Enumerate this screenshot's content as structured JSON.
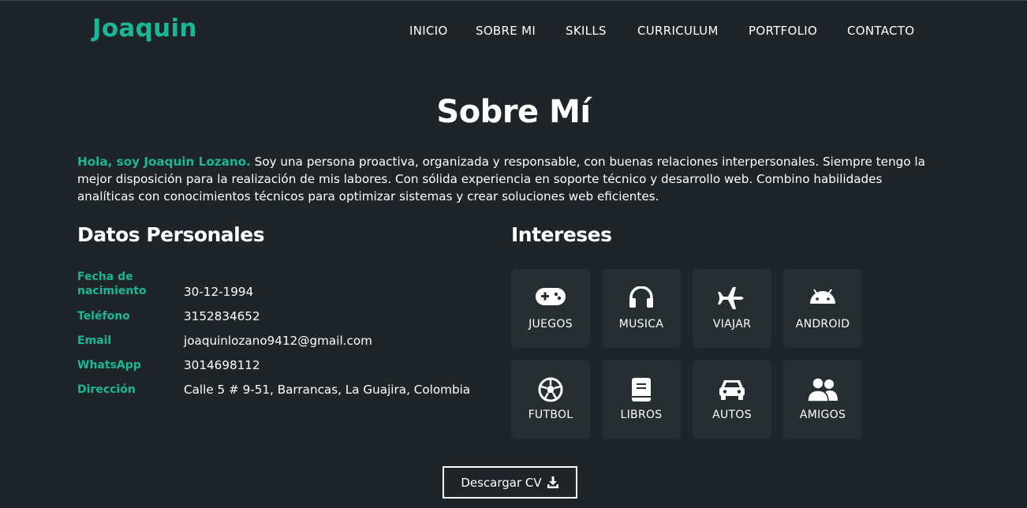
{
  "brand": "Joaquin",
  "nav": [
    "INICIO",
    "SOBRE MI",
    "SKILLS",
    "CURRICULUM",
    "PORTFOLIO",
    "CONTACTO"
  ],
  "section_title": "Sobre Mí",
  "intro": {
    "highlight": "Hola, soy Joaquin Lozano.",
    "text": " Soy una persona proactiva, organizada y responsable, con buenas relaciones interpersonales. Siempre tengo la mejor disposición para la realización de mis labores. Con sólida experiencia en soporte técnico y desarrollo web. Combino habilidades analíticas con conocimientos técnicos para optimizar sistemas y crear soluciones web eficientes."
  },
  "personal": {
    "title": "Datos Personales",
    "rows": [
      {
        "label": "Fecha de nacimiento",
        "value": "30-12-1994"
      },
      {
        "label": "Teléfono",
        "value": "3152834652"
      },
      {
        "label": "Email",
        "value": "joaquinlozano9412@gmail.com"
      },
      {
        "label": "WhatsApp",
        "value": "3014698112"
      },
      {
        "label": "Dirección",
        "value": "Calle 5 # 9-51, Barrancas, La Guajira, Colombia"
      }
    ]
  },
  "interests": {
    "title": "Intereses",
    "items": [
      {
        "label": "JUEGOS",
        "icon": "gamepad-icon"
      },
      {
        "label": "MUSICA",
        "icon": "headphones-icon"
      },
      {
        "label": "VIAJAR",
        "icon": "plane-icon"
      },
      {
        "label": "ANDROID",
        "icon": "android-icon"
      },
      {
        "label": "FUTBOL",
        "icon": "soccer-ball-icon"
      },
      {
        "label": "LIBROS",
        "icon": "book-icon"
      },
      {
        "label": "AUTOS",
        "icon": "car-icon"
      },
      {
        "label": "AMIGOS",
        "icon": "users-icon"
      }
    ]
  },
  "cv_button": "Descargar CV",
  "colors": {
    "background": "#1e2427",
    "accent": "#1cb698",
    "card": "#272e32",
    "text": "#ffffff"
  }
}
